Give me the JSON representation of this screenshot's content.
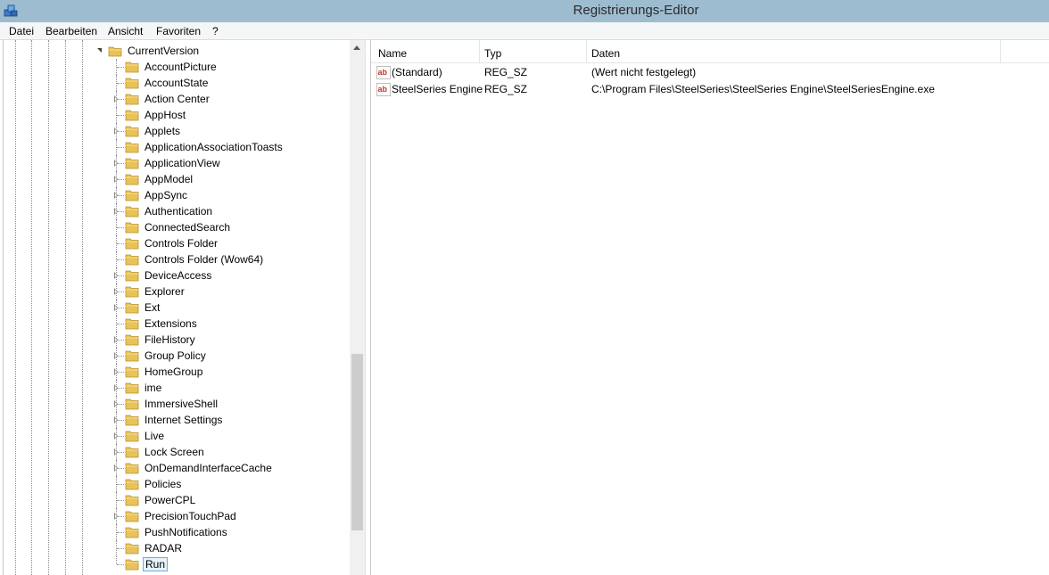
{
  "window": {
    "title": "Registrierungs-Editor",
    "icon": "registry-editor-icon"
  },
  "menu": [
    {
      "label": "Datei"
    },
    {
      "label": "Bearbeiten"
    },
    {
      "label": "Ansicht"
    },
    {
      "label": "Favoriten"
    },
    {
      "label": "?"
    }
  ],
  "tree": {
    "parent": {
      "label": "CurrentVersion",
      "expanded": true
    },
    "nodes": [
      {
        "label": "AccountPicture",
        "has_children": false
      },
      {
        "label": "AccountState",
        "has_children": false
      },
      {
        "label": "Action Center",
        "has_children": true
      },
      {
        "label": "AppHost",
        "has_children": false
      },
      {
        "label": "Applets",
        "has_children": true
      },
      {
        "label": "ApplicationAssociationToasts",
        "has_children": false
      },
      {
        "label": "ApplicationView",
        "has_children": true
      },
      {
        "label": "AppModel",
        "has_children": true
      },
      {
        "label": "AppSync",
        "has_children": true
      },
      {
        "label": "Authentication",
        "has_children": true
      },
      {
        "label": "ConnectedSearch",
        "has_children": false
      },
      {
        "label": "Controls Folder",
        "has_children": false
      },
      {
        "label": "Controls Folder (Wow64)",
        "has_children": false
      },
      {
        "label": "DeviceAccess",
        "has_children": true
      },
      {
        "label": "Explorer",
        "has_children": true
      },
      {
        "label": "Ext",
        "has_children": true
      },
      {
        "label": "Extensions",
        "has_children": false
      },
      {
        "label": "FileHistory",
        "has_children": true
      },
      {
        "label": "Group Policy",
        "has_children": true
      },
      {
        "label": "HomeGroup",
        "has_children": true
      },
      {
        "label": "ime",
        "has_children": true
      },
      {
        "label": "ImmersiveShell",
        "has_children": true
      },
      {
        "label": "Internet Settings",
        "has_children": true
      },
      {
        "label": "Live",
        "has_children": true
      },
      {
        "label": "Lock Screen",
        "has_children": true
      },
      {
        "label": "OnDemandInterfaceCache",
        "has_children": true
      },
      {
        "label": "Policies",
        "has_children": false
      },
      {
        "label": "PowerCPL",
        "has_children": false
      },
      {
        "label": "PrecisionTouchPad",
        "has_children": true
      },
      {
        "label": "PushNotifications",
        "has_children": false
      },
      {
        "label": "RADAR",
        "has_children": false
      },
      {
        "label": "Run",
        "has_children": false,
        "selected": true
      }
    ]
  },
  "list": {
    "columns": [
      {
        "label": "Name"
      },
      {
        "label": "Typ"
      },
      {
        "label": "Daten"
      }
    ],
    "rows": [
      {
        "icon": "string-value-icon",
        "name": "(Standard)",
        "type": "REG_SZ",
        "data": "(Wert nicht festgelegt)"
      },
      {
        "icon": "string-value-icon",
        "name": "SteelSeries Engine",
        "type": "REG_SZ",
        "data": "C:\\Program Files\\SteelSeries\\SteelSeries Engine\\SteelSeriesEngine.exe"
      }
    ]
  },
  "colors": {
    "titlebar": "#9ebccf",
    "folder": "#e8c35a",
    "selection_border": "#7aa6d6"
  }
}
